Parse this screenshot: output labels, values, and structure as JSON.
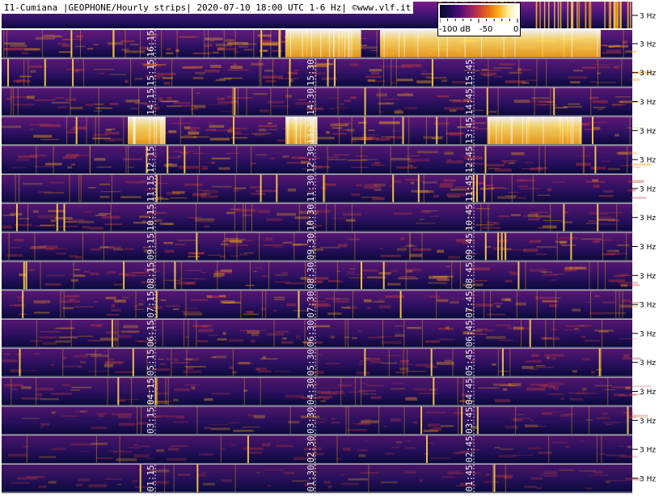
{
  "header": {
    "title": "I1-Cumiana |GEOPHONE/Hourly strips| 2020-07-10 18:00 UTC 1-6 Hz| ©www.vlf.it"
  },
  "scale": {
    "min_label": "-100 dB",
    "mid_label": "-50",
    "max_label": "0"
  },
  "colors": {
    "low": "#0b0a3c",
    "mid": "#7a1d8a",
    "high": "#f6a21a",
    "max": "#ffffff",
    "time_label": "#f2f2f2",
    "frequency_label": "#000000"
  },
  "chart_data": {
    "type": "heatmap",
    "title": "I1-Cumiana |GEOPHONE/Hourly strips| 2020-07-10 18:00 UTC 1-6 Hz| ©www.vlf.it",
    "frequency_range_hz": [
      1,
      6
    ],
    "frequency_tick_label": "3 Hz",
    "color_scale_db": [
      -100,
      0
    ],
    "strips": [
      {
        "hour_utc": 16,
        "time_labels": [
          "16:15"
        ],
        "intensity": 0.62,
        "saturated_segments": [
          [
            0.45,
            0.57
          ],
          [
            0.6,
            0.95
          ]
        ]
      },
      {
        "hour_utc": 15,
        "time_labels": [
          "15:15",
          "15:30",
          "15:45"
        ],
        "intensity": 0.45
      },
      {
        "hour_utc": 14,
        "time_labels": [
          "14:15",
          "14:30",
          "14:45"
        ],
        "intensity": 0.42
      },
      {
        "hour_utc": 13,
        "time_labels": [
          "13:30",
          "13:45"
        ],
        "intensity": 0.52,
        "saturated_segments": [
          [
            0.2,
            0.26
          ],
          [
            0.45,
            0.5
          ],
          [
            0.77,
            0.92
          ]
        ]
      },
      {
        "hour_utc": 12,
        "time_labels": [
          "12:15",
          "12:30",
          "12:45"
        ],
        "intensity": 0.4
      },
      {
        "hour_utc": 11,
        "time_labels": [
          "11:15",
          "11:30",
          "11:45"
        ],
        "intensity": 0.38
      },
      {
        "hour_utc": 10,
        "time_labels": [
          "10:15",
          "10:30",
          "10:45"
        ],
        "intensity": 0.37
      },
      {
        "hour_utc": 9,
        "time_labels": [
          "09:15",
          "09:30",
          "09:45"
        ],
        "intensity": 0.38
      },
      {
        "hour_utc": 8,
        "time_labels": [
          "08:15",
          "08:30",
          "08:45"
        ],
        "intensity": 0.4
      },
      {
        "hour_utc": 7,
        "time_labels": [
          "07:15",
          "07:30",
          "07:45"
        ],
        "intensity": 0.42
      },
      {
        "hour_utc": 6,
        "time_labels": [
          "06:15",
          "06:30",
          "06:45"
        ],
        "intensity": 0.36
      },
      {
        "hour_utc": 5,
        "time_labels": [
          "05:15",
          "05:30",
          "05:45"
        ],
        "intensity": 0.35
      },
      {
        "hour_utc": 4,
        "time_labels": [
          "04:15",
          "04:30",
          "04:45"
        ],
        "intensity": 0.34
      },
      {
        "hour_utc": 3,
        "time_labels": [
          "03:15",
          "03:30",
          "03:45"
        ],
        "intensity": 0.26
      },
      {
        "hour_utc": 2,
        "time_labels": [
          "02:30",
          "02:45"
        ],
        "intensity": 0.18
      },
      {
        "hour_utc": 1,
        "time_labels": [
          "01:15",
          "01:30",
          "01:45"
        ],
        "intensity": 0.17
      }
    ]
  }
}
